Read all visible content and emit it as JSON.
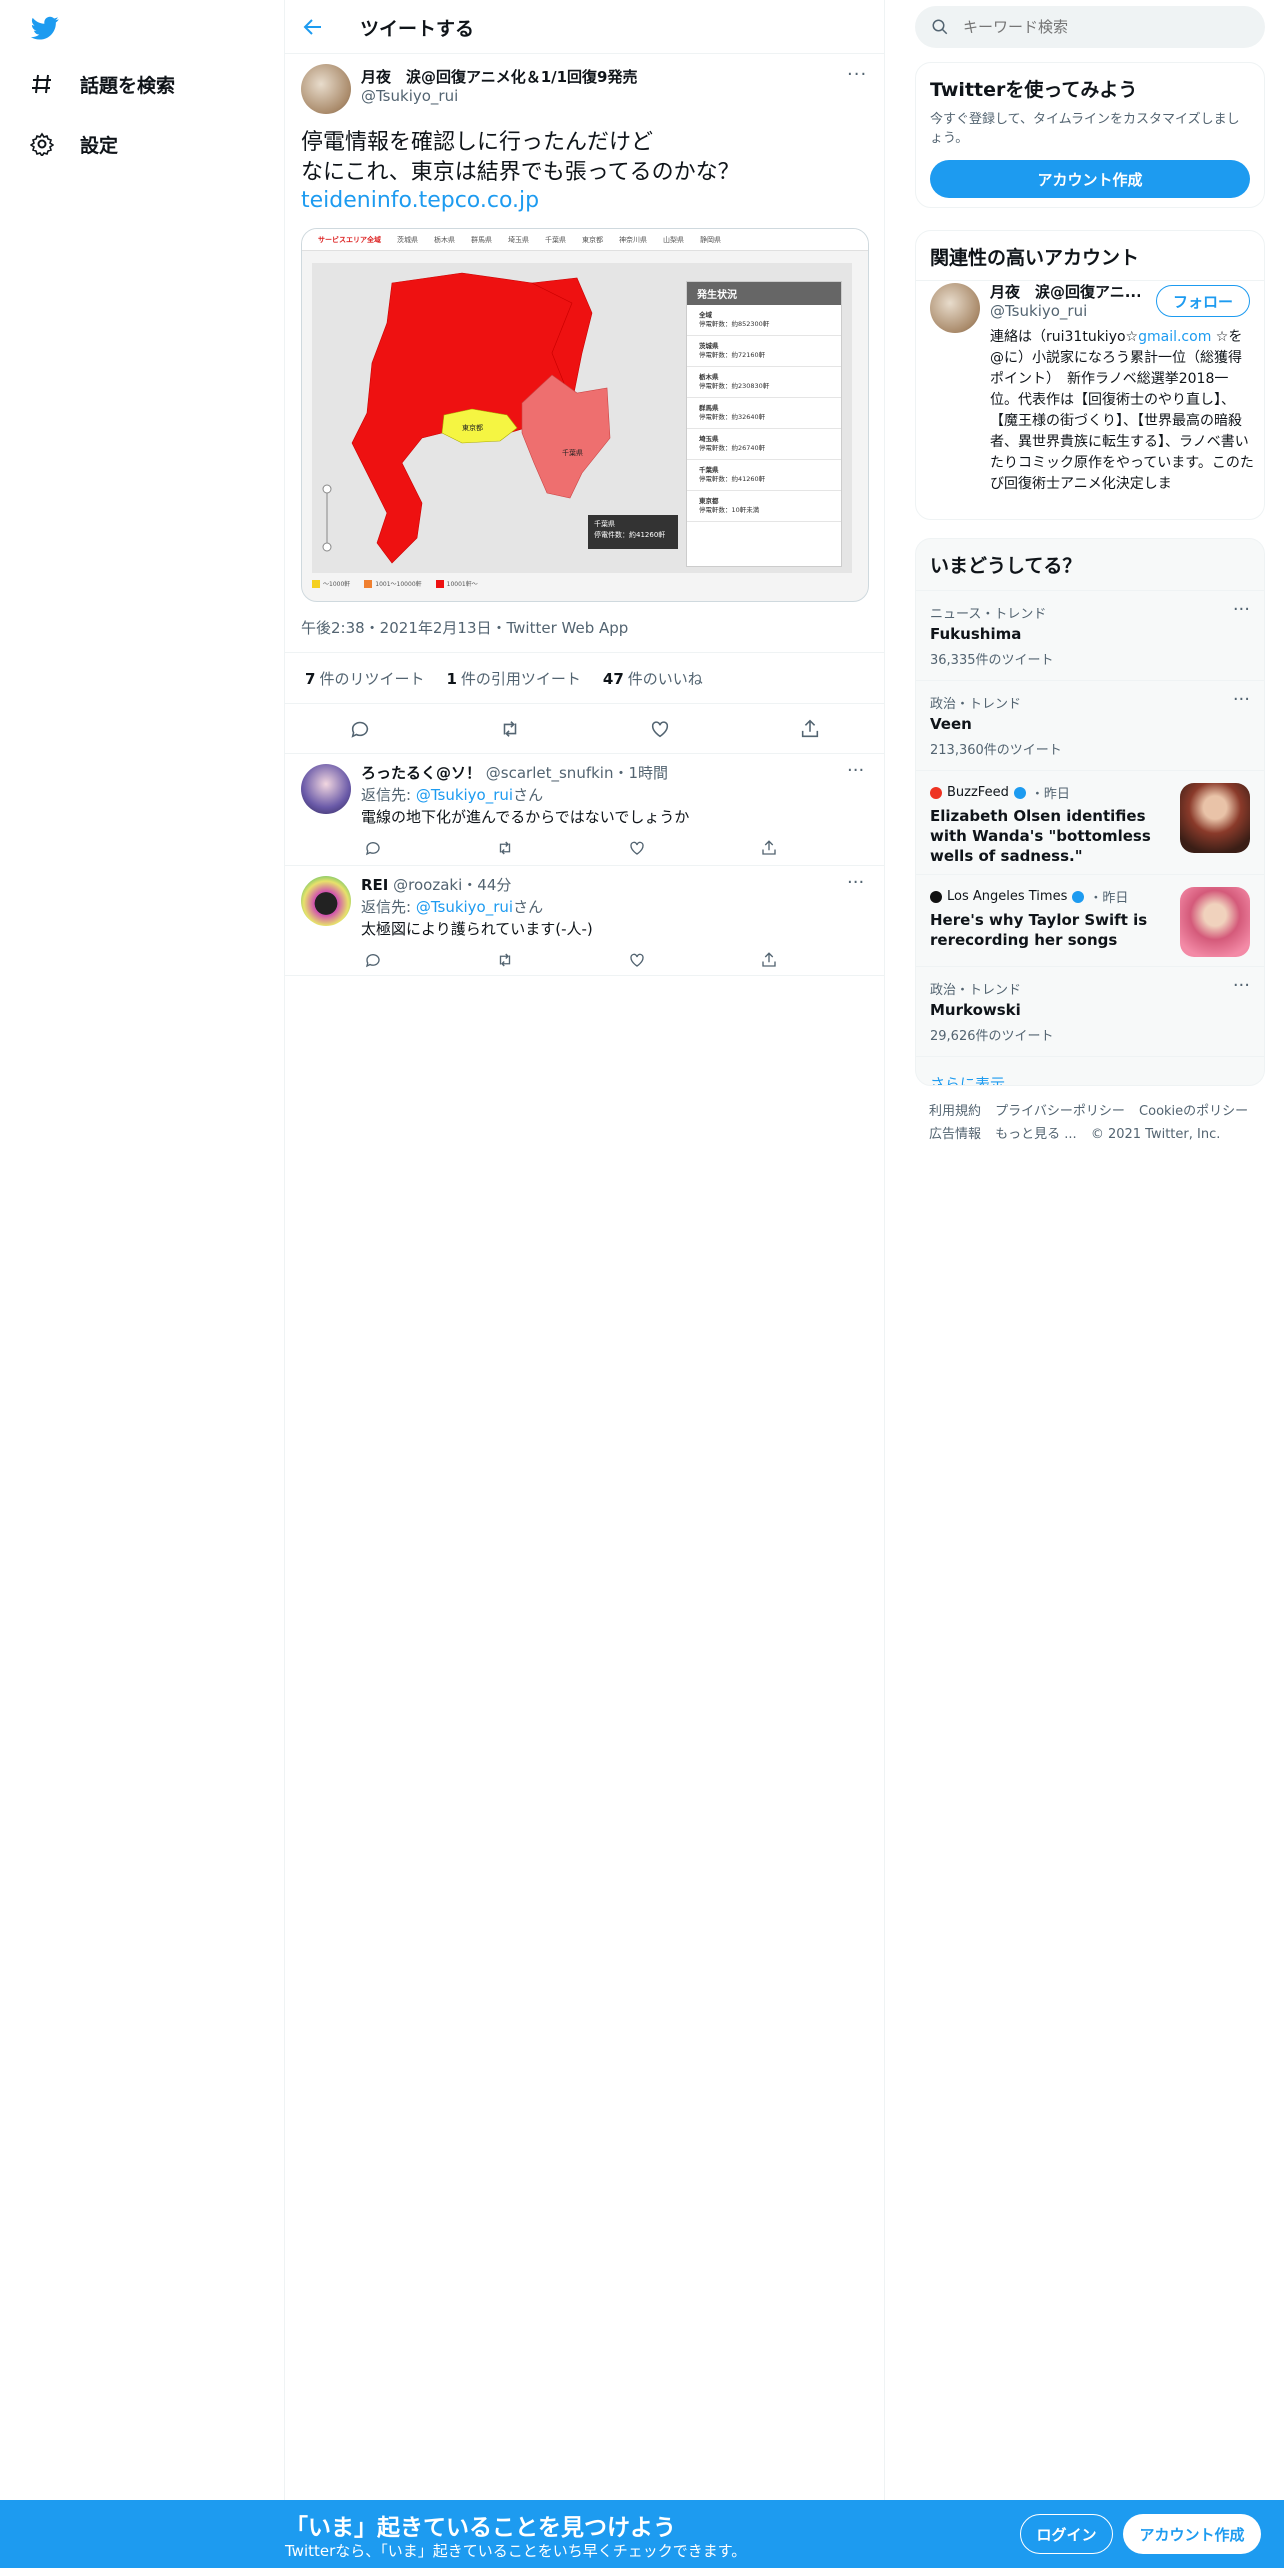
{
  "nav": {
    "explore_label": "話題を検索",
    "settings_label": "設定"
  },
  "header": {
    "title": "ツイートする"
  },
  "tweet": {
    "author_name": "月夜　涙@回復アニメ化＆1/1回復9発売",
    "author_handle": "@Tsukiyo_rui",
    "text": "停電情報を確認しに行ったんだけど\nなにこれ、東京は結界でも張ってるのかな？",
    "link": "teideninfo.tepco.co.jp",
    "meta": "午後2:38・2021年2月13日・Twitter Web App",
    "retweets": "7",
    "retweets_label": "件のリツイート",
    "quotes": "1",
    "quotes_label": "件の引用ツイート",
    "likes": "47",
    "likes_label": "件のいいね"
  },
  "map_image": {
    "tabs": [
      "サービスエリア全域",
      "茨城県",
      "栃木県",
      "群馬県",
      "埼玉県",
      "千葉県",
      "東京都",
      "神奈川県",
      "山梨県",
      "静岡県"
    ],
    "panel_title": "発生状況",
    "panel_items": [
      {
        "name": "全域",
        "value": "停電軒数：約852300軒"
      },
      {
        "name": "茨城県",
        "value": "停電軒数：約72160軒"
      },
      {
        "name": "栃木県",
        "value": "停電軒数：約230830軒"
      },
      {
        "name": "群馬県",
        "value": "停電軒数：約32640軒"
      },
      {
        "name": "埼玉県",
        "value": "停電軒数：約26740軒"
      },
      {
        "name": "千葉県",
        "value": "停電軒数：約41260軒"
      },
      {
        "name": "東京都",
        "value": "停電軒数：10軒未満"
      }
    ],
    "tooltip_title": "千葉県",
    "tooltip_value": "停電件数：約41260軒",
    "tokyo_label": "東京都",
    "chiba_label": "千葉県",
    "legend": [
      "～1000軒",
      "1001～10000軒",
      "10001軒～"
    ],
    "colors": {
      "red": "#ee1111",
      "yellow": "#f5f542",
      "pink": "#ee6f6f"
    }
  },
  "replies": [
    {
      "name": "ろったるく@ソ！",
      "handle": "@scarlet_snufkin",
      "time": "・1時間",
      "to_prefix": "返信先: ",
      "to_handle": "@Tsukiyo_rui",
      "to_suffix": "さん",
      "text": "電線の地下化が進んでるからではないでしょうか"
    },
    {
      "name": "REI",
      "handle": "@roozaki",
      "time": "・44分",
      "to_prefix": "返信先: ",
      "to_handle": "@Tsukiyo_rui",
      "to_suffix": "さん",
      "text": "太極図により護られています(-人-)"
    }
  ],
  "search": {
    "placeholder": "キーワード検索"
  },
  "join": {
    "title": "Twitterを使ってみよう",
    "subtitle": "今すぐ登録して、タイムラインをカスタマイズしましょう。",
    "button": "アカウント作成"
  },
  "related": {
    "title": "関連性の高いアカウント",
    "name": "月夜　涙@回復アニ...",
    "handle": "@Tsukiyo_rui",
    "follow": "フォロー",
    "bio_1": "連絡は（rui31tukiyo☆",
    "bio_link": "gmail.com",
    "bio_2": " ☆を@に）小説家になろう累計一位（総獲得ポイント）　新作ラノベ総選挙2018一位。代表作は【回復術士のやり直し】、【魔王様の街づくり】、【世界最高の暗殺者、異世界貴族に転生する】、ラノベ書いたりコミック原作をやっています。このたび回復術士アニメ化決定しま"
  },
  "trends": {
    "title": "いまどうしてる？",
    "items": [
      {
        "context": "ニュース・トレンド",
        "title": "Fukushima",
        "count": "36,335件のツイート"
      },
      {
        "context": "政治・トレンド",
        "title": "Veen",
        "count": "213,360件のツイート"
      }
    ],
    "news": [
      {
        "source": "BuzzFeed",
        "time": "・昨日",
        "title": "Elizabeth Olsen identifies with Wanda's \"bottomless wells of sadness.\""
      },
      {
        "source": "Los Angeles Times",
        "time": "・昨日",
        "title": "Here's why Taylor Swift is rerecording her songs"
      }
    ],
    "last": {
      "context": "政治・トレンド",
      "title": "Murkowski",
      "count": "29,626件のツイート"
    },
    "more": "さらに表示"
  },
  "footer": {
    "links": [
      "利用規約",
      "プライバシーポリシー",
      "Cookieのポリシー",
      "広告情報",
      "もっと見る ...",
      "© 2021 Twitter, Inc."
    ]
  },
  "bottom_bar": {
    "title": "「いま」起きていることを見つけよう",
    "subtitle": "Twitterなら、「いま」起きていることをいち早くチェックできます。",
    "login": "ログイン",
    "signup": "アカウント作成"
  }
}
